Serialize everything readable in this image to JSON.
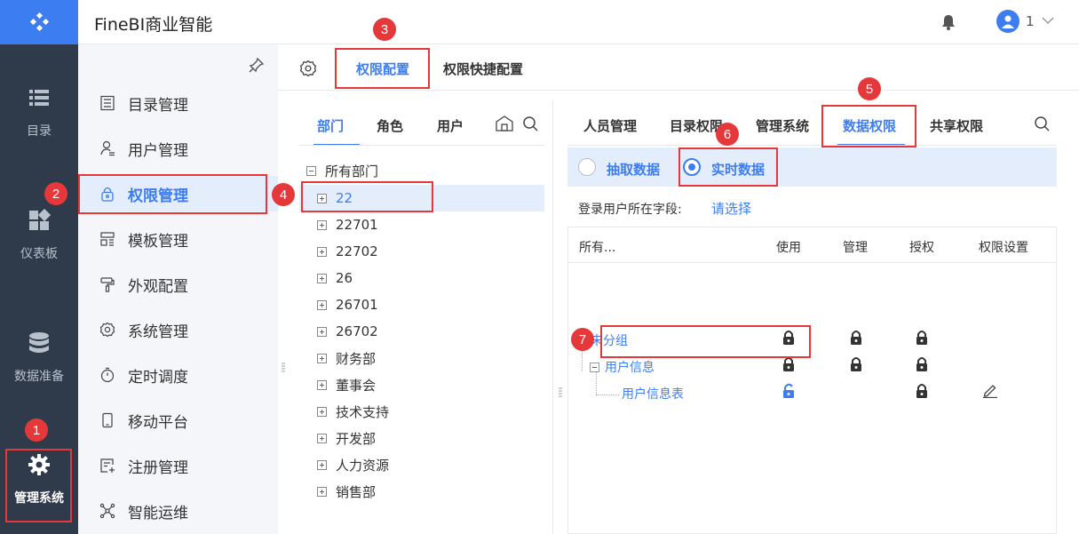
{
  "app": {
    "title": "FineBI商业智能",
    "user_number": "1"
  },
  "rail": {
    "items": [
      {
        "label": "目录",
        "icon": "list-icon"
      },
      {
        "label": "仪表板",
        "icon": "dashboard-icon"
      },
      {
        "label": "数据准备",
        "icon": "database-icon"
      },
      {
        "label": "管理系统",
        "icon": "gear-icon"
      }
    ]
  },
  "menu": {
    "items": [
      {
        "label": "目录管理",
        "icon": "catalog-icon"
      },
      {
        "label": "用户管理",
        "icon": "user-icon"
      },
      {
        "label": "权限管理",
        "icon": "lock-icon"
      },
      {
        "label": "模板管理",
        "icon": "template-icon"
      },
      {
        "label": "外观配置",
        "icon": "paint-roller-icon"
      },
      {
        "label": "系统管理",
        "icon": "settings-icon"
      },
      {
        "label": "定时调度",
        "icon": "timer-icon"
      },
      {
        "label": "移动平台",
        "icon": "mobile-icon"
      },
      {
        "label": "注册管理",
        "icon": "register-icon"
      },
      {
        "label": "智能运维",
        "icon": "network-icon"
      }
    ]
  },
  "main_tabs": [
    "权限配置",
    "权限快捷配置"
  ],
  "dept_tabs": [
    "部门",
    "角色",
    "用户"
  ],
  "tree": {
    "root": "所有部门",
    "children": [
      "22",
      "22701",
      "22702",
      "26",
      "26701",
      "26702",
      "财务部",
      "董事会",
      "技术支持",
      "开发部",
      "人力资源",
      "销售部"
    ]
  },
  "perm_tabs": [
    "人员管理",
    "目录权限",
    "管理系统",
    "数据权限",
    "共享权限"
  ],
  "data_mode": {
    "options": [
      "抽取数据",
      "实时数据"
    ],
    "selected": "实时数据"
  },
  "login_field": {
    "label": "登录用户所在字段:",
    "link": "请选择"
  },
  "perm_table": {
    "headers": [
      "所有...",
      "使用",
      "管理",
      "授权",
      "权限设置"
    ],
    "rows": [
      "未分组",
      "用户信息",
      "用户信息表"
    ]
  },
  "annotations": [
    "1",
    "2",
    "3",
    "4",
    "5",
    "6",
    "7"
  ],
  "colors": {
    "accent": "#3d7df2",
    "rail": "#2f3a4a",
    "annotation": "#e5383b"
  }
}
